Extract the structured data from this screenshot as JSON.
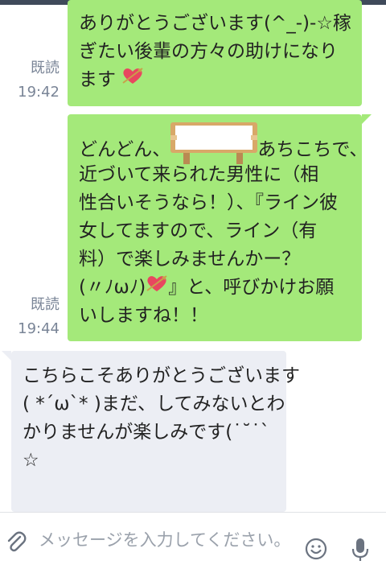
{
  "messages": [
    {
      "direction": "out",
      "read_label": "既読",
      "time": "19:42",
      "lines": [
        "ありがとうございます(^_-)-☆稼",
        "ぎたい後輩の方々の助けになり",
        "ます"
      ],
      "emoji": "heart-arrow"
    },
    {
      "direction": "out",
      "read_label": "既読",
      "time": "19:44",
      "line1_before": "どんどん、",
      "line1_after": "あちこちで、",
      "sticker": "signboard",
      "lines": [
        "近づいて来られた男性に（相",
        "性合いそうなら！）、『ライン彼",
        "女してますので、ライン（有",
        "料）で楽しみませんかー？"
      ],
      "line6_before": "(〃ﾉωﾉ)",
      "line6_after": "』と、呼びかけお願",
      "last_line": "いしますね！！"
    },
    {
      "direction": "in",
      "lines": [
        "こちらこそありがとうございます",
        "( *´ω`* )まだ、してみないとわ",
        "かりませんが楽しみです(˙˘˙`",
        "☆"
      ]
    }
  ],
  "composer": {
    "placeholder": "メッセージを入力してください。",
    "icons": [
      "attach-icon",
      "emoji-icon",
      "microphone-icon"
    ]
  },
  "colors": {
    "outgoing_bubble": "#a4e97a",
    "incoming_bubble": "#eceef4",
    "meta_text": "#7a8597",
    "top_bar": "#3f4a5a"
  }
}
